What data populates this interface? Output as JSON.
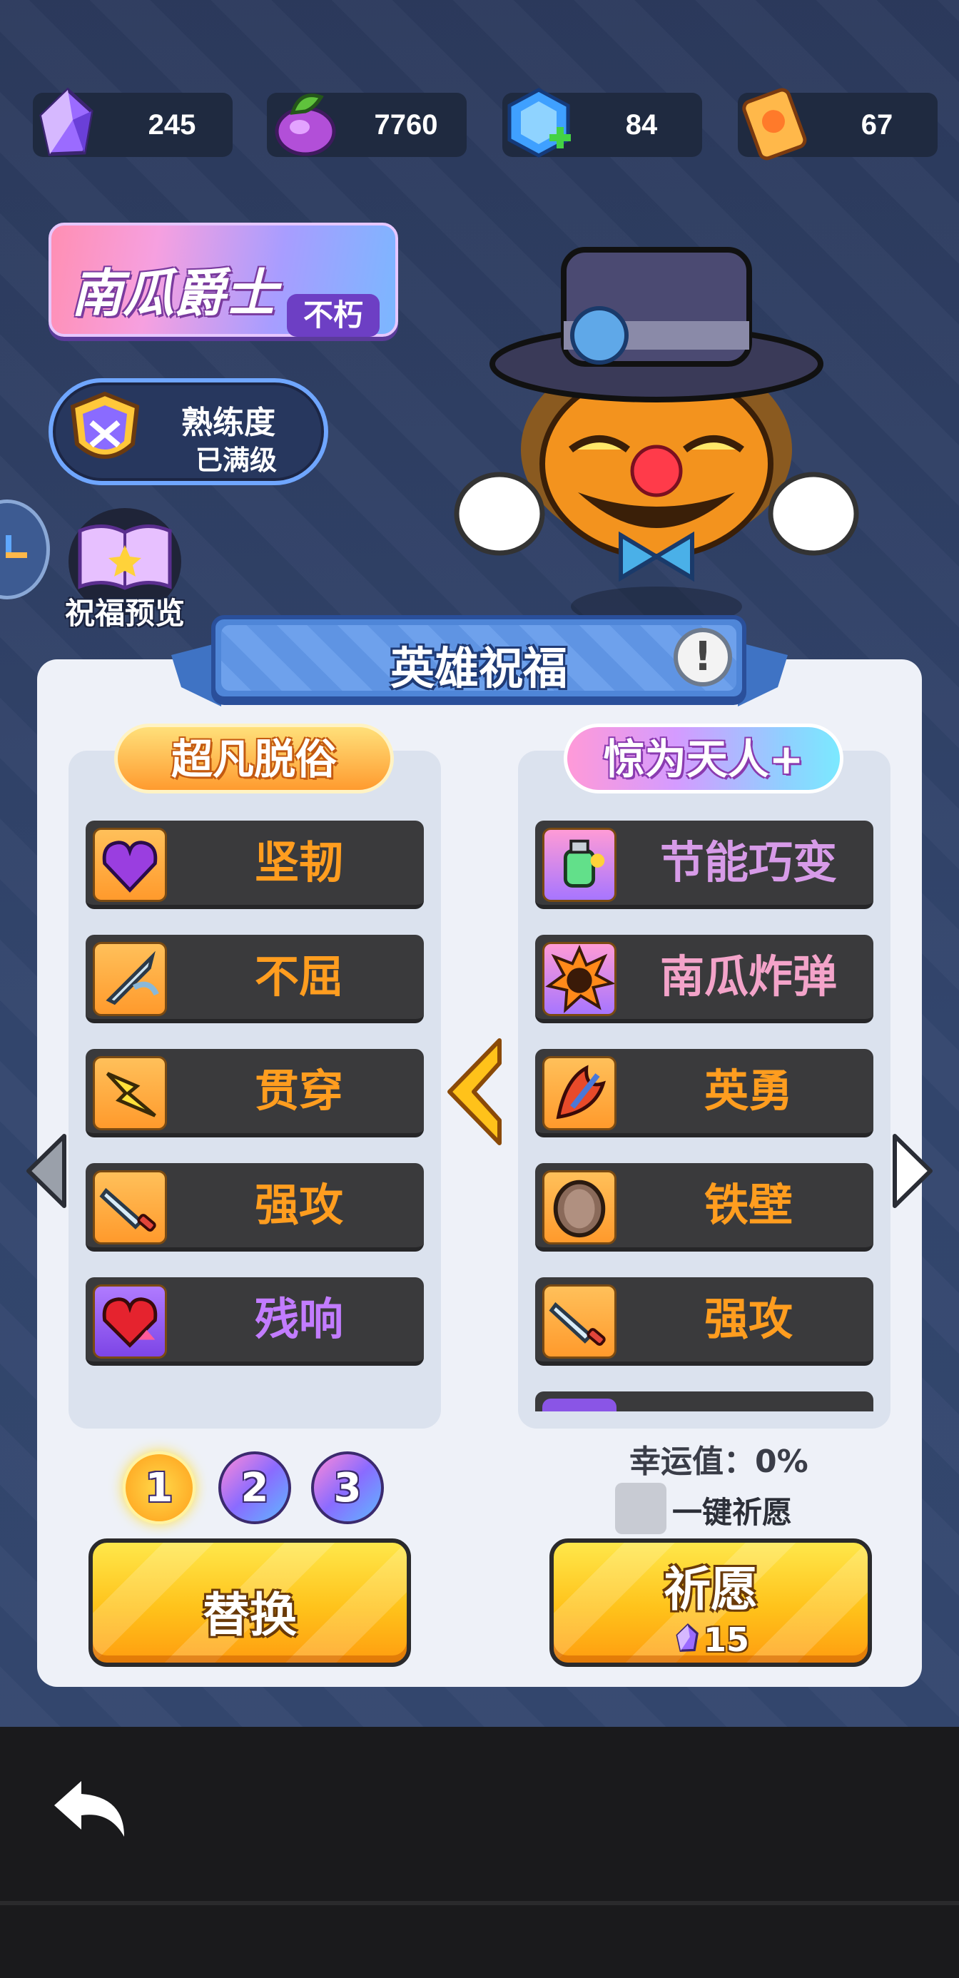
{
  "currencies": [
    {
      "icon": "crystal-icon",
      "value": "245"
    },
    {
      "icon": "pumpkin-seed-icon",
      "value": "7760"
    },
    {
      "icon": "blue-token-icon",
      "value": "84"
    },
    {
      "icon": "ticket-icon",
      "value": "67"
    }
  ],
  "hero": {
    "name": "南瓜爵士",
    "tier": "不朽",
    "mastery_title": "熟练度",
    "mastery_status": "已满级",
    "bless_preview": "祝福预览"
  },
  "panel": {
    "title": "英雄祝福",
    "info": "!",
    "left_title": "超凡脱俗",
    "right_title": "惊为天人+",
    "left_items": [
      {
        "icon": "purple-heart-gem-icon",
        "label": "坚韧"
      },
      {
        "icon": "sword-icon",
        "label": "不屈"
      },
      {
        "icon": "lightning-arrow-icon",
        "label": "贯穿"
      },
      {
        "icon": "sword-attack-icon",
        "label": "强攻"
      },
      {
        "icon": "red-heart-icon",
        "label": "残响"
      }
    ],
    "right_items": [
      {
        "icon": "potion-icon",
        "label": "节能巧变"
      },
      {
        "icon": "pumpkin-bomb-icon",
        "label": "南瓜炸弹"
      },
      {
        "icon": "bravery-icon",
        "label": "英勇"
      },
      {
        "icon": "iron-shield-icon",
        "label": "铁壁"
      },
      {
        "icon": "sword-attack-icon",
        "label": "强攻"
      }
    ],
    "pages": [
      "1",
      "2",
      "3"
    ],
    "luck": "幸运值：0%",
    "one_click_wish": "一键祈愿",
    "replace_button": "替换",
    "wish_button": "祈愿",
    "wish_cost": "15"
  },
  "colors": {
    "accent_orange": "#ff9d1f",
    "accent_purple": "#c27cff",
    "button_yellow": "#ffc21a"
  }
}
